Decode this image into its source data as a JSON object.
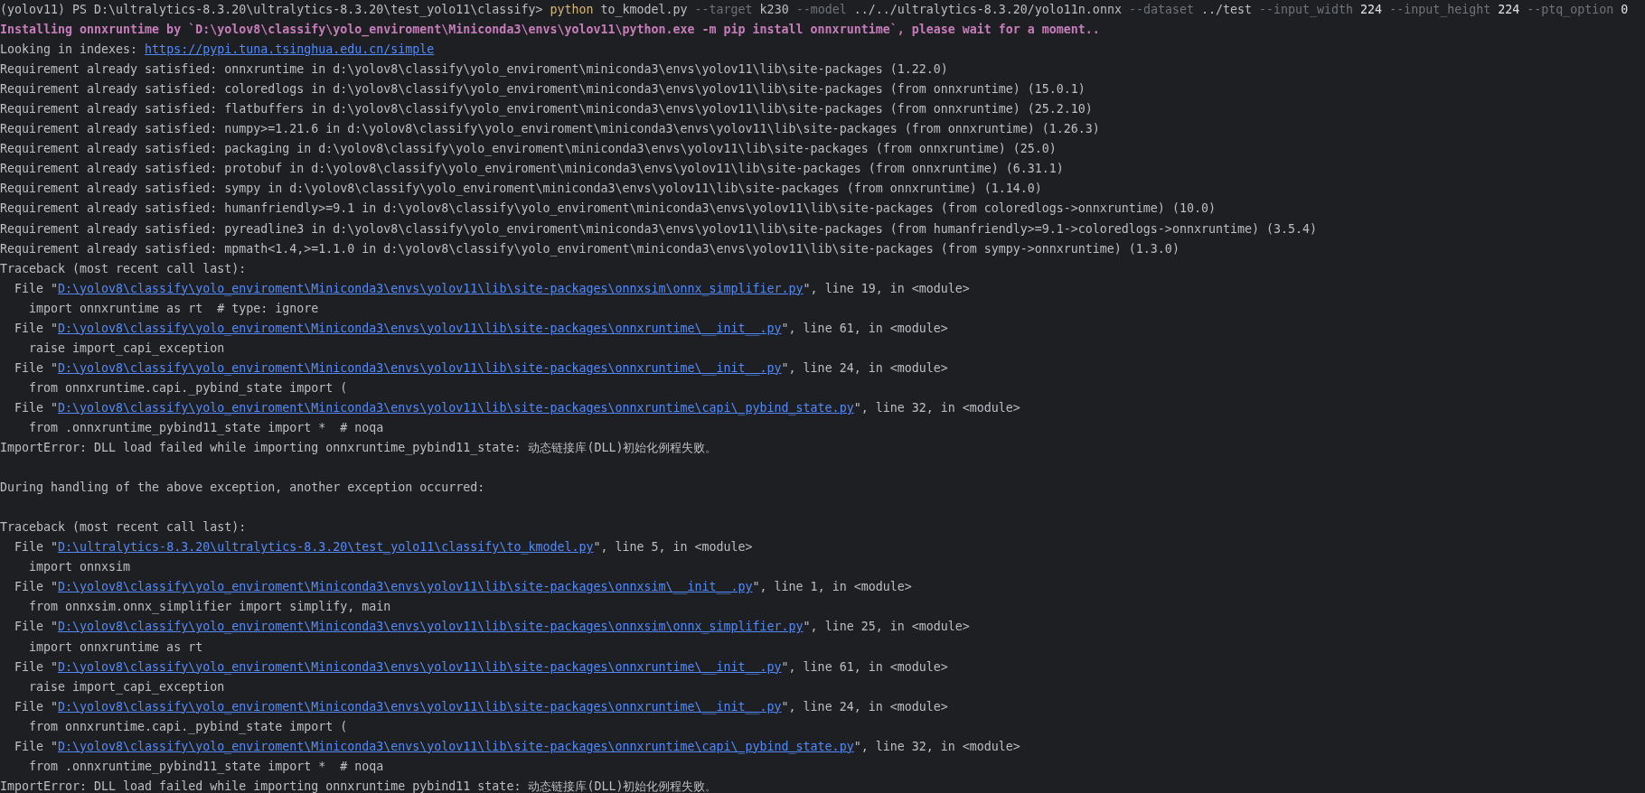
{
  "terminal": {
    "lines": [
      {
        "kind": "text",
        "parts": [
          {
            "kind": "plain",
            "text": "(yolov11) PS D:\\ultralytics-8.3.20\\ultralytics-8.3.20\\test_yolo11\\classify> "
          },
          {
            "kind": "cmd",
            "text": "python"
          },
          {
            "kind": "plain",
            "text": " to_kmodel.py"
          },
          {
            "kind": "opt",
            "text": " --target"
          },
          {
            "kind": "plain",
            "text": " k230"
          },
          {
            "kind": "opt",
            "text": " --model"
          },
          {
            "kind": "plain",
            "text": " ../../ultralytics-8.3.20/yolo11n.onnx"
          },
          {
            "kind": "opt",
            "text": " --dataset"
          },
          {
            "kind": "plain",
            "text": " ../test"
          },
          {
            "kind": "opt",
            "text": " --input_width"
          },
          {
            "kind": "num",
            "text": " 224"
          },
          {
            "kind": "opt",
            "text": " --input_height"
          },
          {
            "kind": "num",
            "text": " 224"
          },
          {
            "kind": "opt",
            "text": " --ptq_option"
          },
          {
            "kind": "num",
            "text": " 0"
          }
        ]
      },
      {
        "kind": "text",
        "parts": [
          {
            "kind": "notice",
            "text": "Installing onnxruntime by `D:\\yolov8\\classify\\yolo_enviroment\\Miniconda3\\envs\\yolov11\\python.exe -m pip install onnxruntime`, please wait for a moment.."
          }
        ]
      },
      {
        "kind": "text",
        "parts": [
          {
            "kind": "plain",
            "text": "Looking in indexes: "
          },
          {
            "kind": "link",
            "text": "https://pypi.tuna.tsinghua.edu.cn/simple"
          }
        ]
      },
      {
        "kind": "text",
        "parts": [
          {
            "kind": "plain",
            "text": "Requirement already satisfied: onnxruntime in d:\\yolov8\\classify\\yolo_enviroment\\miniconda3\\envs\\yolov11\\lib\\site-packages (1.22.0)"
          }
        ]
      },
      {
        "kind": "text",
        "parts": [
          {
            "kind": "plain",
            "text": "Requirement already satisfied: coloredlogs in d:\\yolov8\\classify\\yolo_enviroment\\miniconda3\\envs\\yolov11\\lib\\site-packages (from onnxruntime) (15.0.1)"
          }
        ]
      },
      {
        "kind": "text",
        "parts": [
          {
            "kind": "plain",
            "text": "Requirement already satisfied: flatbuffers in d:\\yolov8\\classify\\yolo_enviroment\\miniconda3\\envs\\yolov11\\lib\\site-packages (from onnxruntime) (25.2.10)"
          }
        ]
      },
      {
        "kind": "text",
        "parts": [
          {
            "kind": "plain",
            "text": "Requirement already satisfied: numpy>=1.21.6 in d:\\yolov8\\classify\\yolo_enviroment\\miniconda3\\envs\\yolov11\\lib\\site-packages (from onnxruntime) (1.26.3)"
          }
        ]
      },
      {
        "kind": "text",
        "parts": [
          {
            "kind": "plain",
            "text": "Requirement already satisfied: packaging in d:\\yolov8\\classify\\yolo_enviroment\\miniconda3\\envs\\yolov11\\lib\\site-packages (from onnxruntime) (25.0)"
          }
        ]
      },
      {
        "kind": "text",
        "parts": [
          {
            "kind": "plain",
            "text": "Requirement already satisfied: protobuf in d:\\yolov8\\classify\\yolo_enviroment\\miniconda3\\envs\\yolov11\\lib\\site-packages (from onnxruntime) (6.31.1)"
          }
        ]
      },
      {
        "kind": "text",
        "parts": [
          {
            "kind": "plain",
            "text": "Requirement already satisfied: sympy in d:\\yolov8\\classify\\yolo_enviroment\\miniconda3\\envs\\yolov11\\lib\\site-packages (from onnxruntime) (1.14.0)"
          }
        ]
      },
      {
        "kind": "text",
        "parts": [
          {
            "kind": "plain",
            "text": "Requirement already satisfied: humanfriendly>=9.1 in d:\\yolov8\\classify\\yolo_enviroment\\miniconda3\\envs\\yolov11\\lib\\site-packages (from coloredlogs->onnxruntime) (10.0)"
          }
        ]
      },
      {
        "kind": "text",
        "parts": [
          {
            "kind": "plain",
            "text": "Requirement already satisfied: pyreadline3 in d:\\yolov8\\classify\\yolo_enviroment\\miniconda3\\envs\\yolov11\\lib\\site-packages (from humanfriendly>=9.1->coloredlogs->onnxruntime) (3.5.4)"
          }
        ]
      },
      {
        "kind": "text",
        "parts": [
          {
            "kind": "plain",
            "text": "Requirement already satisfied: mpmath<1.4,>=1.1.0 in d:\\yolov8\\classify\\yolo_enviroment\\miniconda3\\envs\\yolov11\\lib\\site-packages (from sympy->onnxruntime) (1.3.0)"
          }
        ]
      },
      {
        "kind": "text",
        "parts": [
          {
            "kind": "plain",
            "text": "Traceback (most recent call last):"
          }
        ]
      },
      {
        "kind": "text",
        "parts": [
          {
            "kind": "plain",
            "text": "  File \""
          },
          {
            "kind": "link",
            "text": "D:\\yolov8\\classify\\yolo_enviroment\\Miniconda3\\envs\\yolov11\\lib\\site-packages\\onnxsim\\onnx_simplifier.py"
          },
          {
            "kind": "plain",
            "text": "\", line 19, in <module>"
          }
        ]
      },
      {
        "kind": "text",
        "parts": [
          {
            "kind": "plain",
            "text": "    import onnxruntime as rt  # type: ignore"
          }
        ]
      },
      {
        "kind": "text",
        "parts": [
          {
            "kind": "plain",
            "text": "  File \""
          },
          {
            "kind": "link",
            "text": "D:\\yolov8\\classify\\yolo_enviroment\\Miniconda3\\envs\\yolov11\\lib\\site-packages\\onnxruntime\\__init__.py"
          },
          {
            "kind": "plain",
            "text": "\", line 61, in <module>"
          }
        ]
      },
      {
        "kind": "text",
        "parts": [
          {
            "kind": "plain",
            "text": "    raise import_capi_exception"
          }
        ]
      },
      {
        "kind": "text",
        "parts": [
          {
            "kind": "plain",
            "text": "  File \""
          },
          {
            "kind": "link",
            "text": "D:\\yolov8\\classify\\yolo_enviroment\\Miniconda3\\envs\\yolov11\\lib\\site-packages\\onnxruntime\\__init__.py"
          },
          {
            "kind": "plain",
            "text": "\", line 24, in <module>"
          }
        ]
      },
      {
        "kind": "text",
        "parts": [
          {
            "kind": "plain",
            "text": "    from onnxruntime.capi._pybind_state import ("
          }
        ]
      },
      {
        "kind": "text",
        "parts": [
          {
            "kind": "plain",
            "text": "  File \""
          },
          {
            "kind": "link",
            "text": "D:\\yolov8\\classify\\yolo_enviroment\\Miniconda3\\envs\\yolov11\\lib\\site-packages\\onnxruntime\\capi\\_pybind_state.py"
          },
          {
            "kind": "plain",
            "text": "\", line 32, in <module>"
          }
        ]
      },
      {
        "kind": "text",
        "parts": [
          {
            "kind": "plain",
            "text": "    from .onnxruntime_pybind11_state import *  # noqa"
          }
        ]
      },
      {
        "kind": "text",
        "parts": [
          {
            "kind": "plain",
            "text": "ImportError: DLL load failed while importing onnxruntime_pybind11_state: 动态链接库(DLL)初始化例程失败。"
          }
        ]
      },
      {
        "kind": "blank"
      },
      {
        "kind": "text",
        "parts": [
          {
            "kind": "plain",
            "text": "During handling of the above exception, another exception occurred:"
          }
        ]
      },
      {
        "kind": "blank"
      },
      {
        "kind": "text",
        "parts": [
          {
            "kind": "plain",
            "text": "Traceback (most recent call last):"
          }
        ]
      },
      {
        "kind": "text",
        "parts": [
          {
            "kind": "plain",
            "text": "  File \""
          },
          {
            "kind": "link",
            "text": "D:\\ultralytics-8.3.20\\ultralytics-8.3.20\\test_yolo11\\classify\\to_kmodel.py"
          },
          {
            "kind": "plain",
            "text": "\", line 5, in <module>"
          }
        ]
      },
      {
        "kind": "text",
        "parts": [
          {
            "kind": "plain",
            "text": "    import onnxsim"
          }
        ]
      },
      {
        "kind": "text",
        "parts": [
          {
            "kind": "plain",
            "text": "  File \""
          },
          {
            "kind": "link",
            "text": "D:\\yolov8\\classify\\yolo_enviroment\\Miniconda3\\envs\\yolov11\\lib\\site-packages\\onnxsim\\__init__.py"
          },
          {
            "kind": "plain",
            "text": "\", line 1, in <module>"
          }
        ]
      },
      {
        "kind": "text",
        "parts": [
          {
            "kind": "plain",
            "text": "    from onnxsim.onnx_simplifier import simplify, main"
          }
        ]
      },
      {
        "kind": "text",
        "parts": [
          {
            "kind": "plain",
            "text": "  File \""
          },
          {
            "kind": "link",
            "text": "D:\\yolov8\\classify\\yolo_enviroment\\Miniconda3\\envs\\yolov11\\lib\\site-packages\\onnxsim\\onnx_simplifier.py"
          },
          {
            "kind": "plain",
            "text": "\", line 25, in <module>"
          }
        ]
      },
      {
        "kind": "text",
        "parts": [
          {
            "kind": "plain",
            "text": "    import onnxruntime as rt"
          }
        ]
      },
      {
        "kind": "text",
        "parts": [
          {
            "kind": "plain",
            "text": "  File \""
          },
          {
            "kind": "link",
            "text": "D:\\yolov8\\classify\\yolo_enviroment\\Miniconda3\\envs\\yolov11\\lib\\site-packages\\onnxruntime\\__init__.py"
          },
          {
            "kind": "plain",
            "text": "\", line 61, in <module>"
          }
        ]
      },
      {
        "kind": "text",
        "parts": [
          {
            "kind": "plain",
            "text": "    raise import_capi_exception"
          }
        ]
      },
      {
        "kind": "text",
        "parts": [
          {
            "kind": "plain",
            "text": "  File \""
          },
          {
            "kind": "link",
            "text": "D:\\yolov8\\classify\\yolo_enviroment\\Miniconda3\\envs\\yolov11\\lib\\site-packages\\onnxruntime\\__init__.py"
          },
          {
            "kind": "plain",
            "text": "\", line 24, in <module>"
          }
        ]
      },
      {
        "kind": "text",
        "parts": [
          {
            "kind": "plain",
            "text": "    from onnxruntime.capi._pybind_state import ("
          }
        ]
      },
      {
        "kind": "text",
        "parts": [
          {
            "kind": "plain",
            "text": "  File \""
          },
          {
            "kind": "link",
            "text": "D:\\yolov8\\classify\\yolo_enviroment\\Miniconda3\\envs\\yolov11\\lib\\site-packages\\onnxruntime\\capi\\_pybind_state.py"
          },
          {
            "kind": "plain",
            "text": "\", line 32, in <module>"
          }
        ]
      },
      {
        "kind": "text",
        "parts": [
          {
            "kind": "plain",
            "text": "    from .onnxruntime_pybind11_state import *  # noqa"
          }
        ]
      },
      {
        "kind": "text",
        "parts": [
          {
            "kind": "plain",
            "text": "ImportError: DLL load failed while importing onnxruntime_pybind11_state: 动态链接库(DLL)初始化例程失败。"
          }
        ]
      }
    ]
  }
}
